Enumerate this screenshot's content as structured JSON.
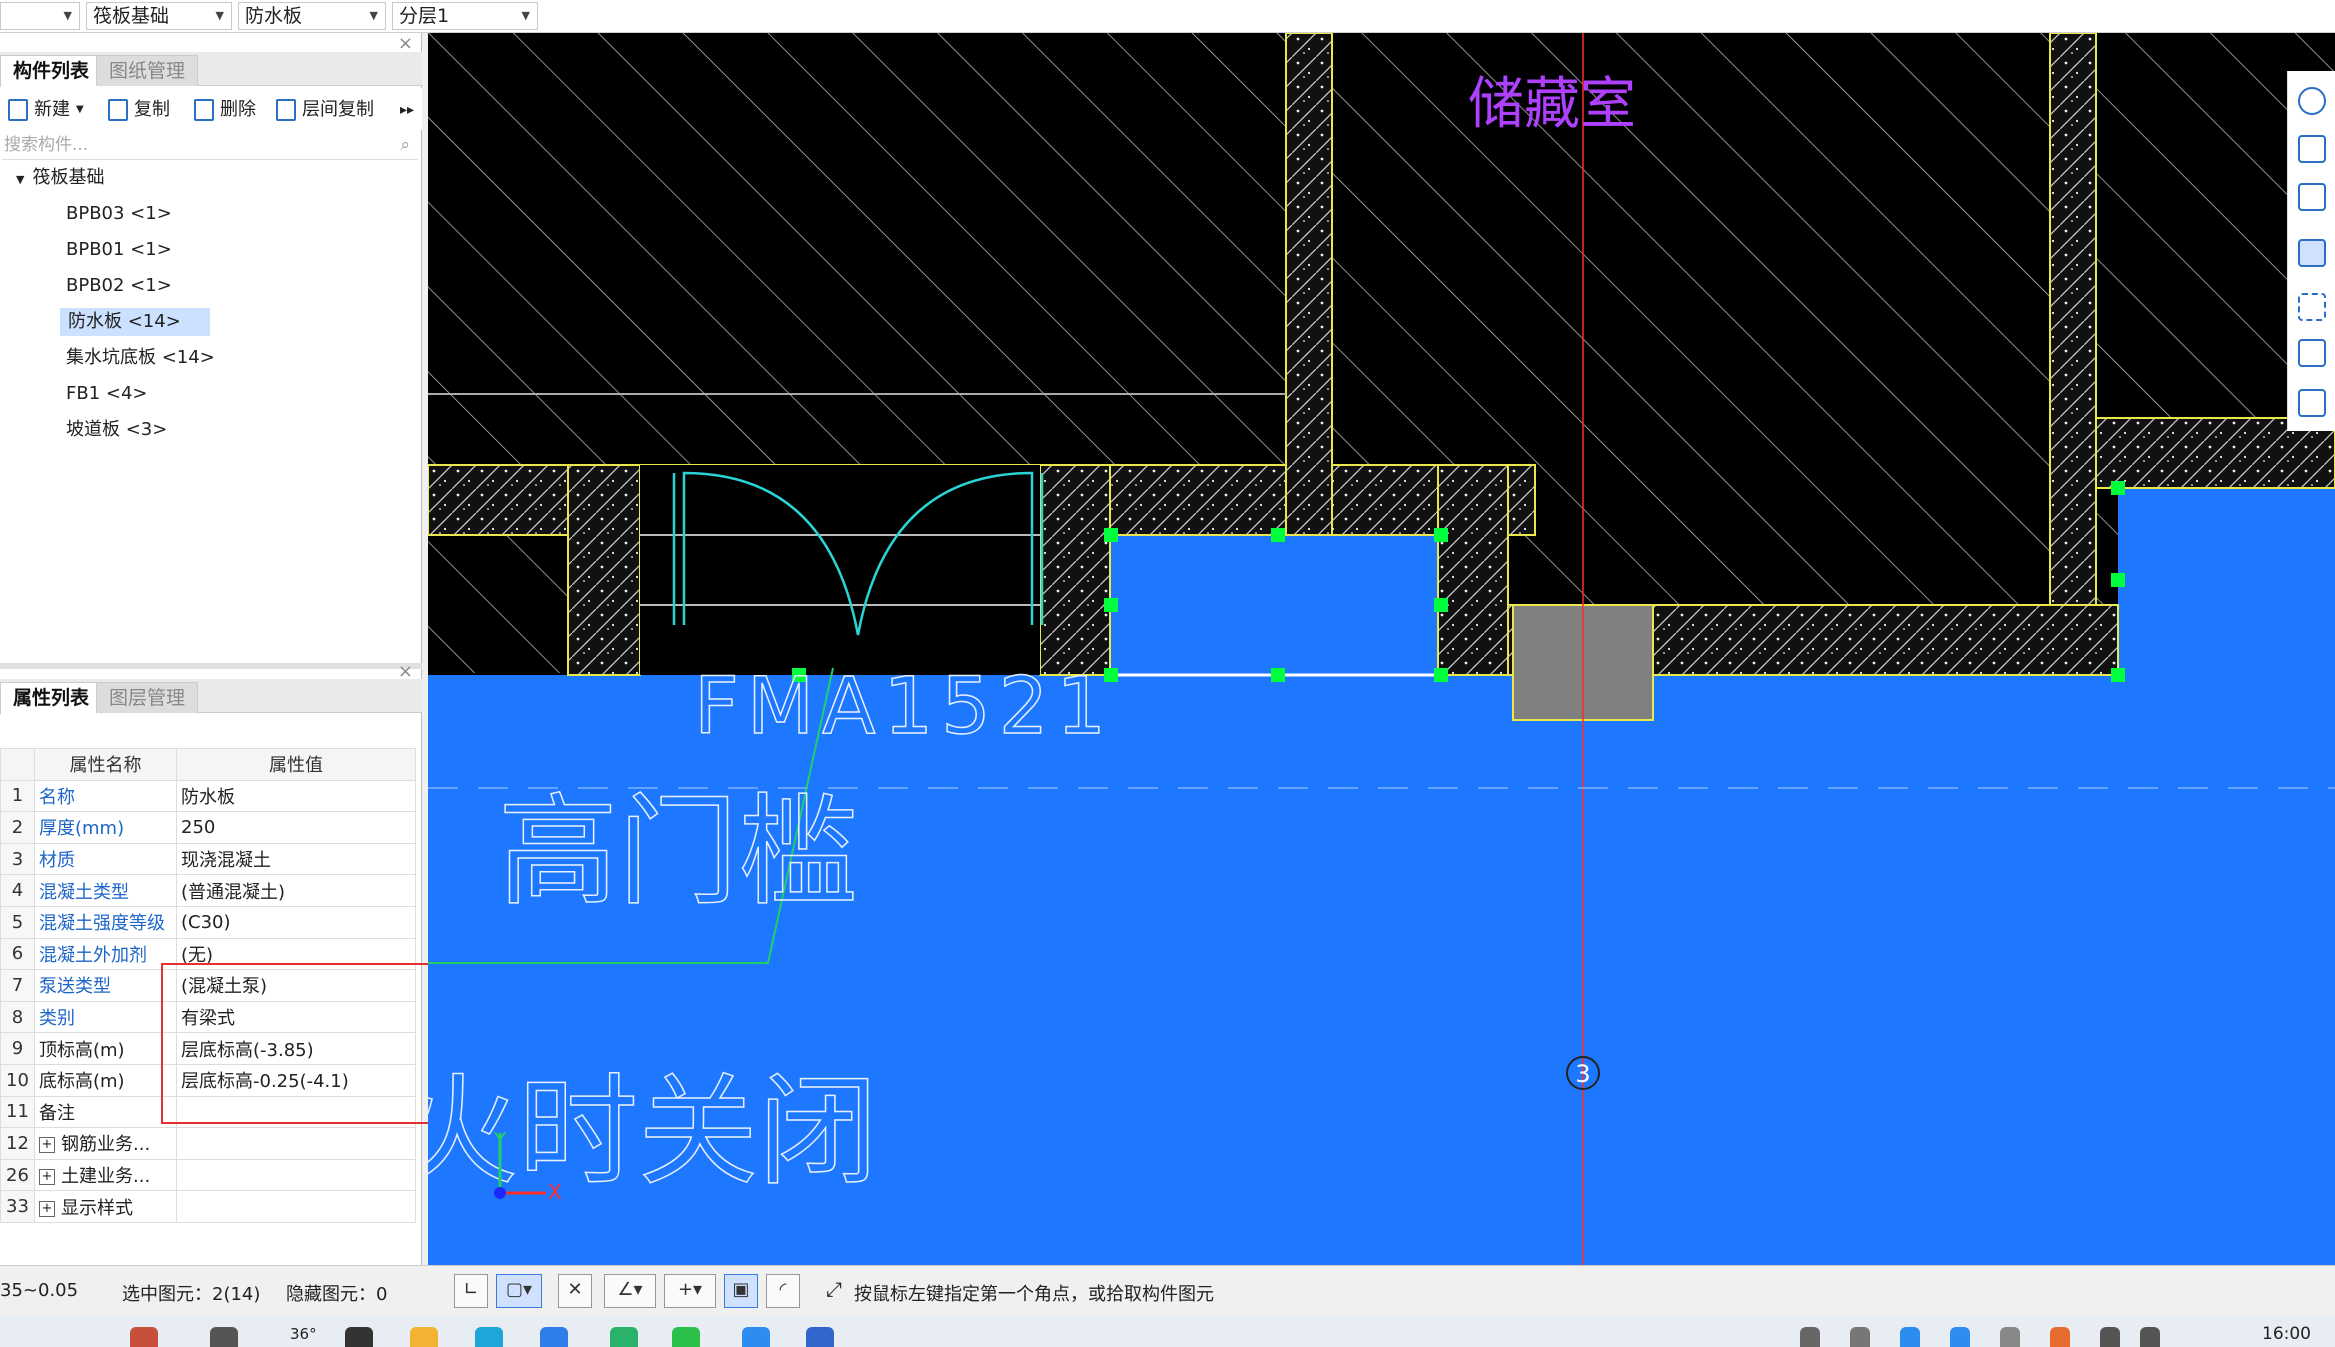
{
  "top_selects": [
    {
      "value": ""
    },
    {
      "value": "筏板基础"
    },
    {
      "value": "防水板"
    },
    {
      "value": "分层1"
    }
  ],
  "component_panel": {
    "tabs": [
      "构件列表",
      "图纸管理"
    ],
    "toolbar": [
      "新建",
      "复制",
      "删除",
      "层间复制"
    ],
    "search_placeholder": "搜索构件...",
    "tree_root": "筏板基础",
    "items": [
      "BPB03 <1>",
      "BPB01 <1>",
      "BPB02 <1>",
      "防水板 <14>",
      "集水坑底板 <14>",
      "FB1 <4>",
      "坡道板 <3>"
    ],
    "selected_index": 3
  },
  "property_panel": {
    "tabs": [
      "属性列表",
      "图层管理"
    ],
    "header": [
      "属性名称",
      "属性值"
    ],
    "rows": [
      {
        "n": "1",
        "k": "名称",
        "v": "防水板",
        "blue": true
      },
      {
        "n": "2",
        "k": "厚度(mm)",
        "v": "250",
        "blue": true
      },
      {
        "n": "3",
        "k": "材质",
        "v": "现浇混凝土",
        "blue": true
      },
      {
        "n": "4",
        "k": "混凝土类型",
        "v": "(普通混凝土)",
        "blue": true
      },
      {
        "n": "5",
        "k": "混凝土强度等级",
        "v": "(C30)",
        "blue": true
      },
      {
        "n": "6",
        "k": "混凝土外加剂",
        "v": "(无)",
        "blue": true
      },
      {
        "n": "7",
        "k": "泵送类型",
        "v": "(混凝土泵)",
        "blue": true
      },
      {
        "n": "8",
        "k": "类别",
        "v": "有梁式",
        "blue": true
      },
      {
        "n": "9",
        "k": "顶标高(m)",
        "v": "层底标高(-3.85)",
        "blue": false
      },
      {
        "n": "10",
        "k": "底标高(m)",
        "v": "层底标高-0.25(-4.1)",
        "blue": false
      },
      {
        "n": "11",
        "k": "备注",
        "v": "",
        "blue": false
      },
      {
        "n": "12",
        "k": "钢筋业务...",
        "v": "",
        "blue": false,
        "expand": true
      },
      {
        "n": "26",
        "k": "土建业务...",
        "v": "",
        "blue": false,
        "expand": true
      },
      {
        "n": "33",
        "k": "显示样式",
        "v": "",
        "blue": false,
        "expand": true
      }
    ]
  },
  "canvas": {
    "room_label": "储藏室",
    "door_label": "FMA1521",
    "text_upper": "高门槛",
    "text_lower": "火时关闭",
    "axis_number": "3",
    "axis_y": "Y",
    "axis_x": "X",
    "colors": {
      "slab": "#1e78ff",
      "wall": "#e8e84a",
      "node": "#00ff3c",
      "room_label": "#b040ff"
    }
  },
  "status": {
    "elev": "35~0.05",
    "selected": "选中图元：2(14)",
    "hidden": "隐藏图元：0",
    "hint": "按鼠标左键指定第一个角点，或拾取构件图元",
    "weather": "36°",
    "time": "16:00"
  }
}
